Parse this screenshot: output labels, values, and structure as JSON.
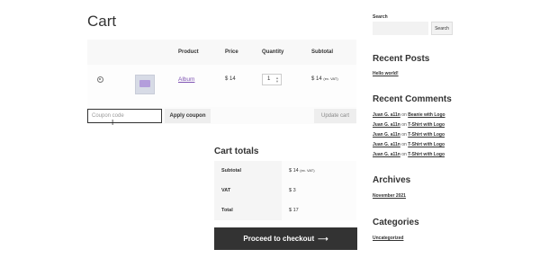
{
  "page": {
    "title": "Cart"
  },
  "cart_table": {
    "headers": {
      "product": "Product",
      "price": "Price",
      "quantity": "Quantity",
      "subtotal": "Subtotal"
    },
    "item": {
      "name": "Album",
      "price": "$ 14",
      "quantity": "1",
      "subtotal": "$ 14",
      "subtotal_note": "(ex. VAT)"
    }
  },
  "coupon": {
    "placeholder": "Coupon code",
    "apply_label": "Apply coupon",
    "update_label": "Update cart"
  },
  "totals": {
    "title": "Cart totals",
    "rows": [
      {
        "label": "Subtotal",
        "value": "$ 14",
        "note": "(ex. VAT)"
      },
      {
        "label": "VAT",
        "value": "$ 3"
      },
      {
        "label": "Total",
        "value": "$ 17"
      }
    ],
    "checkout_label": "Proceed to checkout",
    "checkout_arrow": "⟶"
  },
  "sidebar": {
    "search_label": "Search",
    "search_button": "Search",
    "recent_posts_title": "Recent Posts",
    "recent_posts": [
      "Hello world!"
    ],
    "recent_comments_title": "Recent Comments",
    "recent_comments": [
      {
        "author": "Juan G. a11n",
        "on": "on",
        "post": "Beanie with Logo"
      },
      {
        "author": "Juan G. a11n",
        "on": "on",
        "post": "T-Shirt with Logo"
      },
      {
        "author": "Juan G. a11n",
        "on": "on",
        "post": "T-Shirt with Logo"
      },
      {
        "author": "Juan G. a11n",
        "on": "on",
        "post": "T-Shirt with Logo"
      },
      {
        "author": "Juan G. a11n",
        "on": "on",
        "post": "T-Shirt with Logo"
      }
    ],
    "archives_title": "Archives",
    "archives": [
      "November 2021"
    ],
    "categories_title": "Categories",
    "categories": [
      "Uncategorized"
    ]
  },
  "icons": {
    "remove": "remove-circle-icon",
    "cursor": "text-cursor-icon",
    "arrow": "arrow-right-icon",
    "product_thumb": "album-thumbnail"
  }
}
